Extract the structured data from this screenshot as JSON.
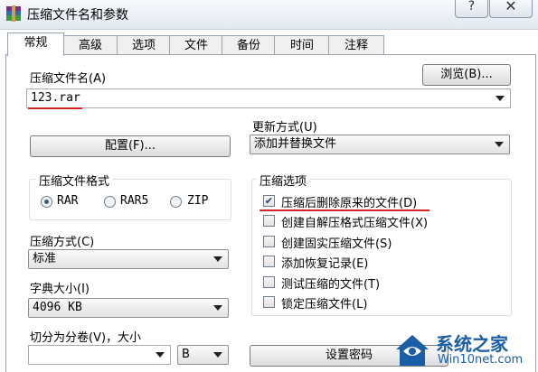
{
  "window": {
    "title": "压缩文件名和参数",
    "help_label": "?",
    "close_label": "✕"
  },
  "tabs": [
    "常规",
    "高级",
    "选项",
    "文件",
    "备份",
    "时间",
    "注释"
  ],
  "general": {
    "archive_name_label": "压缩文件名(A)",
    "archive_name_value": "123.rar",
    "browse_label": "浏览(B)...",
    "update_mode_label": "更新方式(U)",
    "update_mode_value": "添加并替换文件",
    "profiles_label": "配置(F)...",
    "format_group_label": "压缩文件格式",
    "formats": [
      "RAR",
      "RAR5",
      "ZIP"
    ],
    "selected_format": "RAR",
    "method_label": "压缩方式(C)",
    "method_value": "标准",
    "dict_label": "字典大小(I)",
    "dict_value": "4096 KB",
    "split_label": "切分为分卷(V)，大小",
    "split_unit_value": "B",
    "set_password_label": "设置密码",
    "options_group_label": "压缩选项",
    "options": [
      {
        "label": "压缩后删除原来的文件(D)",
        "checked": true
      },
      {
        "label": "创建自解压格式压缩文件(X)",
        "checked": false
      },
      {
        "label": "创建固实压缩文件(S)",
        "checked": false
      },
      {
        "label": "添加恢复记录(E)",
        "checked": false
      },
      {
        "label": "测试压缩的文件(T)",
        "checked": false
      },
      {
        "label": "锁定压缩文件(L)",
        "checked": false
      }
    ]
  },
  "watermark": {
    "brand": "系统之家",
    "url": "Win10net.com"
  },
  "colors": {
    "highlight": "#d0262a",
    "watermark_blue": "#1a5ea8"
  }
}
